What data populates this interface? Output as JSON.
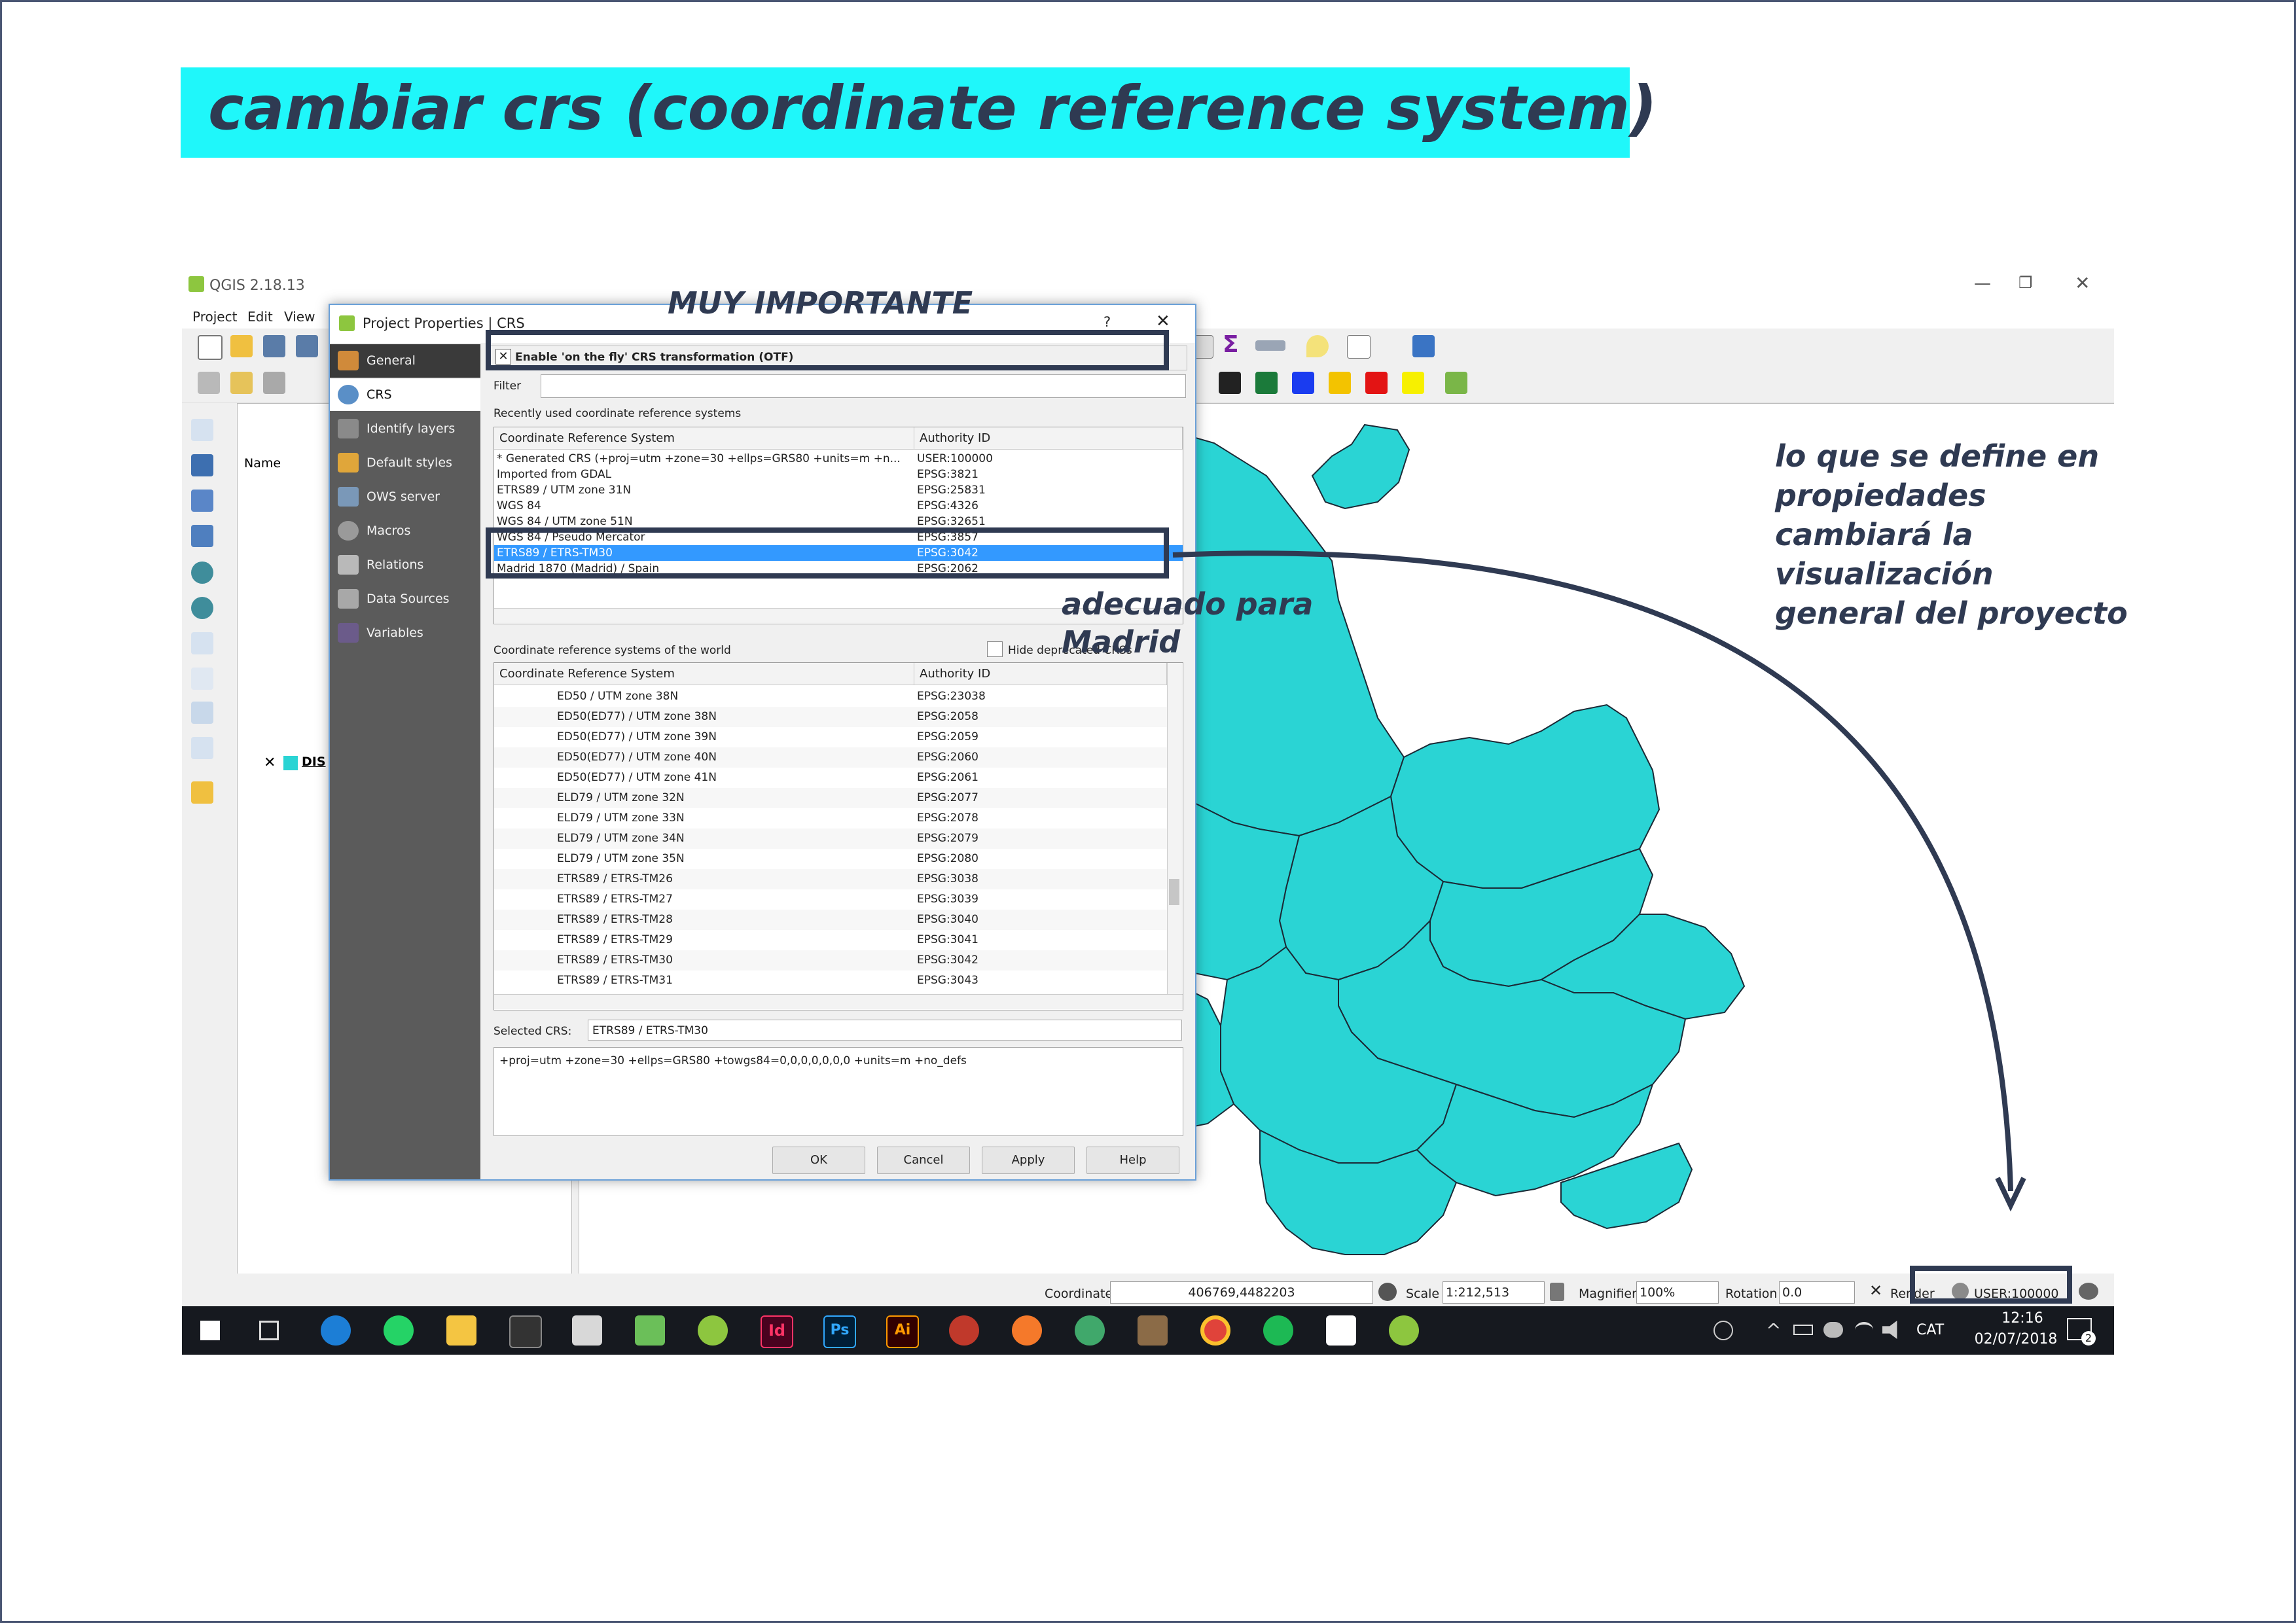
{
  "slide": {
    "title": "cambiar crs (coordinate reference system)",
    "anno_important": "MUY IMPORTANTE",
    "anno_madrid_l1": "adecuado para",
    "anno_madrid_l2": "Madrid",
    "anno_right_l1": "lo que se define en",
    "anno_right_l2": "propiedades",
    "anno_right_l3": "cambiará la",
    "anno_right_l4": "visualización",
    "anno_right_l5": "general del proyecto",
    "colors": {
      "title_band": "#1ff7fa",
      "annotation": "#2f3a52",
      "map_fill": "#2ad4d4"
    }
  },
  "qgis": {
    "window_title": "QGIS 2.18.13",
    "menu": [
      "Project",
      "Edit",
      "View"
    ],
    "layers_header": "Name",
    "layer_item": "DIS",
    "status": {
      "coordinate_label": "Coordinate",
      "coordinate_value": "406769,4482203",
      "scale_label": "Scale",
      "scale_value": "1:212,513",
      "magnifier_label": "Magnifier",
      "magnifier_value": "100%",
      "rotation_label": "Rotation",
      "rotation_value": "0.0",
      "render_label": "Render",
      "crs_value": "USER:100000"
    },
    "taskbar": {
      "lang": "CAT",
      "time": "12:16",
      "date": "02/07/2018",
      "notif": "2",
      "apps": [
        "teamviewer",
        "whatsapp",
        "explorer",
        "terminal",
        "inkscape",
        "photos",
        "qgis",
        "indesign",
        "photoshop",
        "illustrator",
        "davinci",
        "blender",
        "atom",
        "gimp",
        "chrome",
        "spotify",
        "sticky",
        "qgis2"
      ],
      "app_labels": {
        "indesign": "Id",
        "photoshop": "Ps",
        "illustrator": "Ai"
      }
    }
  },
  "dialog": {
    "title": "Project Properties | CRS",
    "help": "?",
    "close": "✕",
    "sidebar": [
      "General",
      "CRS",
      "Identify layers",
      "Default styles",
      "OWS server",
      "Macros",
      "Relations",
      "Data Sources",
      "Variables"
    ],
    "otf_label": "Enable 'on the fly' CRS transformation (OTF)",
    "filter_label": "Filter",
    "recent_label": "Recently used coordinate reference systems",
    "col_crs": "Coordinate Reference System",
    "col_auth": "Authority ID",
    "recent_rows": [
      {
        "crs": "* Generated CRS (+proj=utm +zone=30 +ellps=GRS80 +units=m +n...",
        "auth": "USER:100000"
      },
      {
        "crs": "Imported from GDAL",
        "auth": "EPSG:3821"
      },
      {
        "crs": "ETRS89 / UTM zone 31N",
        "auth": "EPSG:25831"
      },
      {
        "crs": "WGS 84",
        "auth": "EPSG:4326"
      },
      {
        "crs": "WGS 84 / UTM zone 51N",
        "auth": "EPSG:32651"
      },
      {
        "crs": "WGS 84 / Pseudo Mercator",
        "auth": "EPSG:3857"
      },
      {
        "crs": "ETRS89 / ETRS-TM30",
        "auth": "EPSG:3042"
      },
      {
        "crs": "Madrid 1870 (Madrid) / Spain",
        "auth": "EPSG:2062"
      }
    ],
    "selected_recent_index": 6,
    "world_label": "Coordinate reference systems of the world",
    "hide_label": "Hide deprecated CRSs",
    "world_rows": [
      {
        "crs": "ED50 / UTM zone 38N",
        "auth": "EPSG:23038"
      },
      {
        "crs": "ED50(ED77) / UTM zone 38N",
        "auth": "EPSG:2058"
      },
      {
        "crs": "ED50(ED77) / UTM zone 39N",
        "auth": "EPSG:2059"
      },
      {
        "crs": "ED50(ED77) / UTM zone 40N",
        "auth": "EPSG:2060"
      },
      {
        "crs": "ED50(ED77) / UTM zone 41N",
        "auth": "EPSG:2061"
      },
      {
        "crs": "ELD79 / UTM zone 32N",
        "auth": "EPSG:2077"
      },
      {
        "crs": "ELD79 / UTM zone 33N",
        "auth": "EPSG:2078"
      },
      {
        "crs": "ELD79 / UTM zone 34N",
        "auth": "EPSG:2079"
      },
      {
        "crs": "ELD79 / UTM zone 35N",
        "auth": "EPSG:2080"
      },
      {
        "crs": "ETRS89 / ETRS-TM26",
        "auth": "EPSG:3038"
      },
      {
        "crs": "ETRS89 / ETRS-TM27",
        "auth": "EPSG:3039"
      },
      {
        "crs": "ETRS89 / ETRS-TM28",
        "auth": "EPSG:3040"
      },
      {
        "crs": "ETRS89 / ETRS-TM29",
        "auth": "EPSG:3041"
      },
      {
        "crs": "ETRS89 / ETRS-TM30",
        "auth": "EPSG:3042"
      },
      {
        "crs": "ETRS89 / ETRS-TM31",
        "auth": "EPSG:3043"
      }
    ],
    "selected_crs_label": "Selected CRS:",
    "selected_crs_value": "ETRS89 / ETRS-TM30",
    "proj_string": "+proj=utm +zone=30 +ellps=GRS80 +towgs84=0,0,0,0,0,0,0 +units=m +no_defs",
    "buttons": {
      "ok": "OK",
      "cancel": "Cancel",
      "apply": "Apply",
      "help": "Help"
    }
  }
}
